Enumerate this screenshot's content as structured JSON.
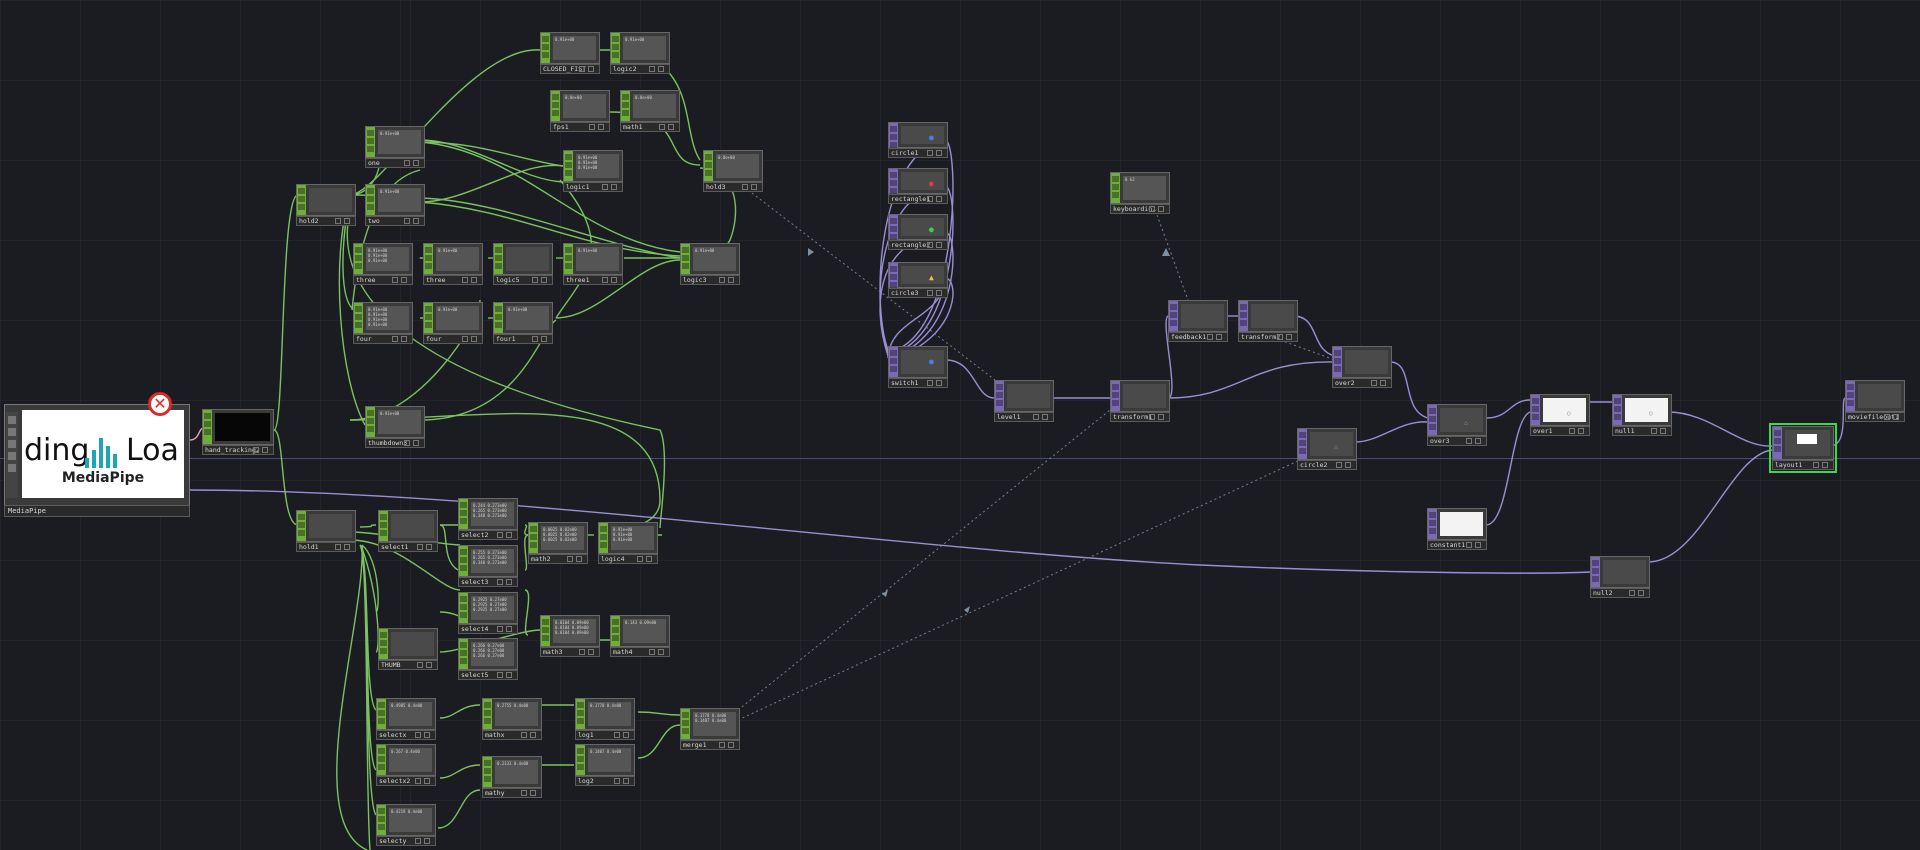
{
  "app": {
    "accent_green": "#6fae3a",
    "accent_purple": "#7b69b8",
    "selection_color": "#3cd650",
    "error_icon": "error-x-icon"
  },
  "mediapipe": {
    "name": "MediaPipe",
    "preview_left": "ding",
    "preview_right": "Loa",
    "preview_brand": "MediaPipe",
    "logo_icon": "mediapipe-logo-icon"
  },
  "nodes": {
    "hand_tracking2": "hand_tracking2",
    "CLOSED_FIST": "CLOSED_FIST",
    "logic2": "logic2",
    "fps1": "fps1",
    "math1": "math1",
    "one": "one",
    "two": "two",
    "hold2": "hold2",
    "logic1": "logic1",
    "hold3": "hold3",
    "three": "three",
    "three_b": "three",
    "logic5": "logic5",
    "three1": "three1",
    "logic3": "logic3",
    "four": "four",
    "four_b": "four",
    "four1": "four1",
    "thumbdown": "thumbdown3",
    "hold1": "hold1",
    "select1": "select1",
    "select2": "select2",
    "select3": "select3",
    "math2": "math2",
    "logic4": "logic4",
    "select4": "select4",
    "select5": "select5",
    "math3": "math3",
    "math4": "math4",
    "thumb": "THUMB",
    "selectx": "selectx",
    "selectx2": "selectx2",
    "mathx": "mathx",
    "mathy": "mathy",
    "log1": "log1",
    "log2": "log2",
    "selecty": "selecty",
    "merge1": "merge1",
    "circle1": "circle1",
    "rectangle1": "rectangle1",
    "rectangle2": "rectangle2",
    "circle3": "circle3",
    "switch1": "switch1",
    "level1": "level1",
    "transform1": "transform1",
    "keyboardin1": "keyboardin1",
    "feedback1": "feedback1",
    "transform2": "transform2",
    "over2": "over2",
    "circle2": "circle2",
    "over3": "over3",
    "over1": "over1",
    "null1": "null1",
    "layout1": "layout1",
    "moviefileout1": "moviefileout1",
    "constant1": "constant1",
    "null2": "null2"
  },
  "previews": {
    "closed_fist": "0.91e+00",
    "logic2": "0.91e+00",
    "fps1": "0.0e+00",
    "math1": "0.0e+00",
    "one": "0.91e+00",
    "two": "0.91e+00",
    "logic1": "0.91e+00\n0.91e+00\n0.91e+00",
    "hold3": "0.0e+00",
    "three": "0.91e+00\n0.91e+00\n0.91e+00",
    "three_b": "0.91e+00",
    "three1": "0.91e+00",
    "logic3": "0.91e+00",
    "four": "0.91e+00\n0.91e+00\n0.91e+00\n0.91e+00",
    "four_b": "0.91e+00",
    "four1": "0.91e+00",
    "thumbdown": "0.91e+00",
    "select2": "0.244 0.273e00\n0.265 0.273e00\n0.348 0.273e00",
    "select3": "0.255 0.273e00\n0.265 0.273e00\n0.348 0.273e00",
    "math2": "0.0025 0.02e00\n0.0025 0.02e00\n0.0025 0.02e00",
    "logic4": "0.91e+00\n0.91e+00\n0.91e+00",
    "select4": "0.2925 0.27e00\n0.2925 0.27e00\n0.2925 0.27e00",
    "select5": "0.266 0.27e00\n0.266 0.27e00\n0.266 0.27e00",
    "math3": "0.0104 0.09e00\n0.0104 0.09e00\n0.0104 0.09e00",
    "math4": "0.143 0.09e00",
    "selectx": "0.4985 0.4e00",
    "selectx2": "0.267 0.4e00",
    "mathx": "0.2755 0.4e00",
    "mathy": "0.2131 0.4e00",
    "log1": "0.1778 0.4e00",
    "log2": "0.1407 0.4e00",
    "selecty": "0.4219 0.4e00",
    "merge1": "0.1778 0.4e00\n0.1407 0.4e00",
    "keyboardin1": "0 k2"
  }
}
